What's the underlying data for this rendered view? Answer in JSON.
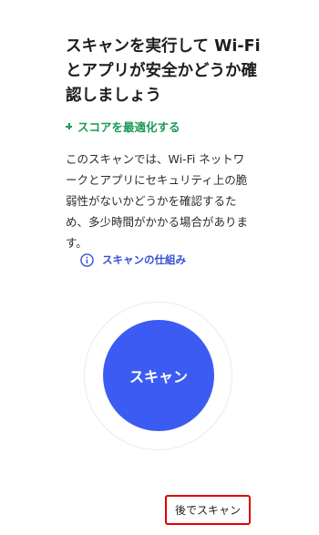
{
  "header": {
    "title_lines": [
      "スキャンを実行して Wi-Fi",
      "とアプリが安全かどうか確",
      "認しましょう"
    ]
  },
  "optimize_link": {
    "label": "スコアを最適化する",
    "icon": "plus-icon",
    "color": "#1b9a55"
  },
  "description": {
    "lines": [
      "このスキャンでは、Wi-Fi ネットワ",
      "ークとアプリにセキュリティ上の脆",
      "弱性がないかどうかを確認するた",
      "め、多少時間がかかる場合がありま",
      "す。"
    ]
  },
  "how_it_works": {
    "label": "スキャンの仕組み",
    "icon": "info-icon",
    "color": "#3550d8"
  },
  "scan": {
    "label": "スキャン",
    "color": "#3c5bf2"
  },
  "later": {
    "label": "後でスキャン",
    "highlight_color": "#e00000"
  }
}
